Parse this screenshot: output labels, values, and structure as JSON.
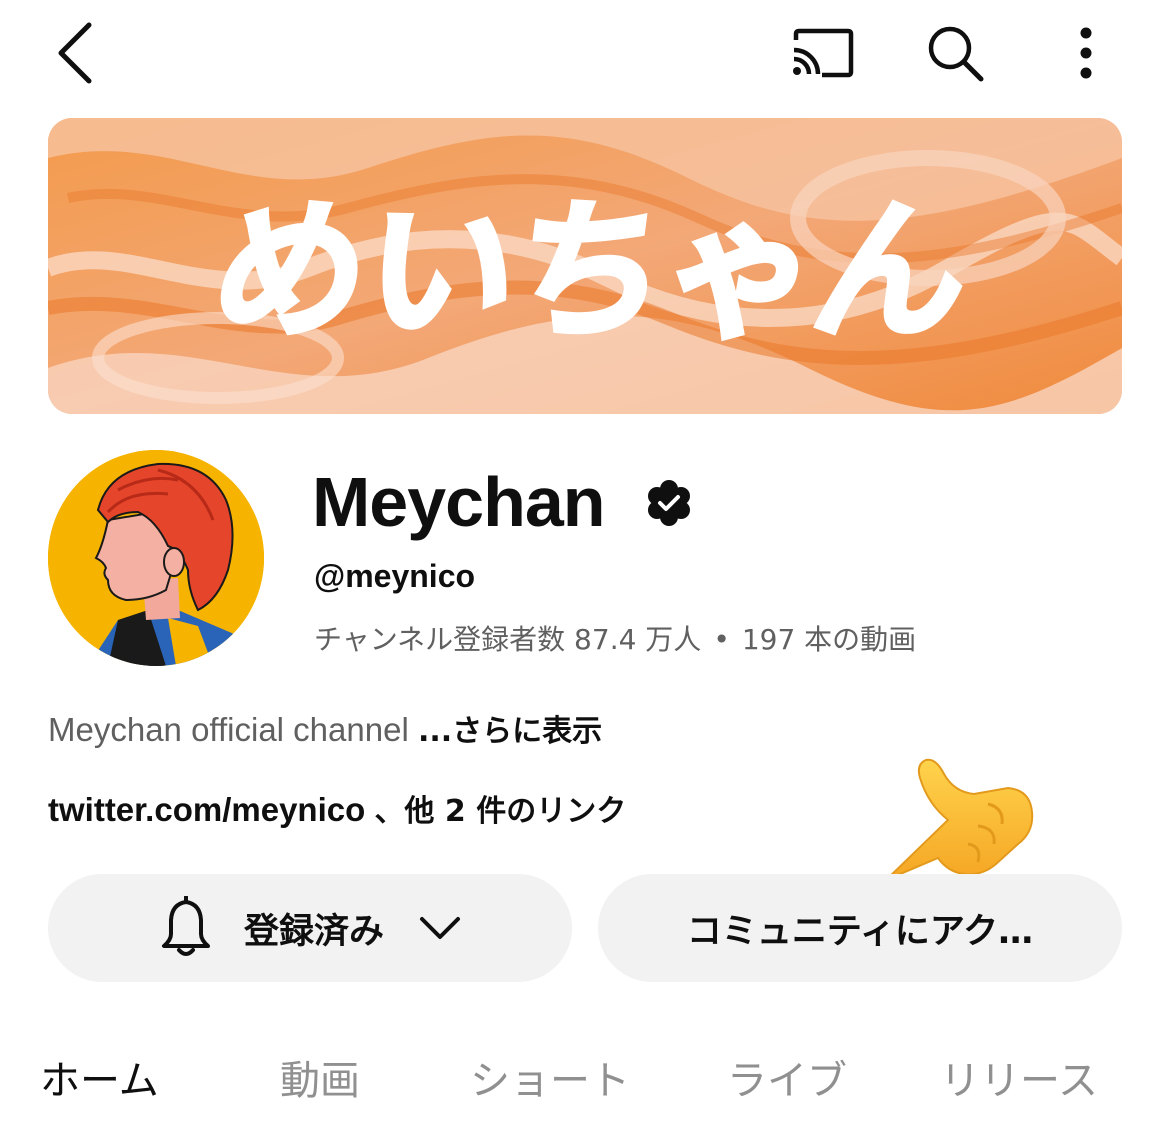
{
  "topbar": {
    "back_icon": "chevron-left-icon",
    "cast_icon": "cast-icon",
    "search_icon": "search-icon",
    "more_icon": "more-vertical-icon"
  },
  "banner": {
    "logo_text": "めいちゃん",
    "colors": {
      "primary": "#f08a3c",
      "light": "#f7c9a8",
      "pale": "#f9d6c4"
    }
  },
  "channel": {
    "name": "Meychan",
    "verified_icon": "verified-badge-icon",
    "handle": "@meynico",
    "subscribers": "チャンネル登録者数 87.4 万人",
    "separator": "•",
    "videos": "197 本の動画",
    "description": "Meychan official channel",
    "more": "...さらに表示",
    "link": "twitter.com/meynico",
    "link_more": "、他 2 件のリンク"
  },
  "buttons": {
    "subscribed": "登録済み",
    "bell_icon": "bell-icon",
    "dropdown_icon": "chevron-down-icon",
    "community": "コミュニティにアク…"
  },
  "overlay": {
    "emoji": "pointing-hand-icon"
  },
  "tabs": [
    {
      "label": "ホーム",
      "active": true
    },
    {
      "label": "動画",
      "active": false
    },
    {
      "label": "ショート",
      "active": false
    },
    {
      "label": "ライブ",
      "active": false
    },
    {
      "label": "リリース",
      "active": false
    }
  ]
}
